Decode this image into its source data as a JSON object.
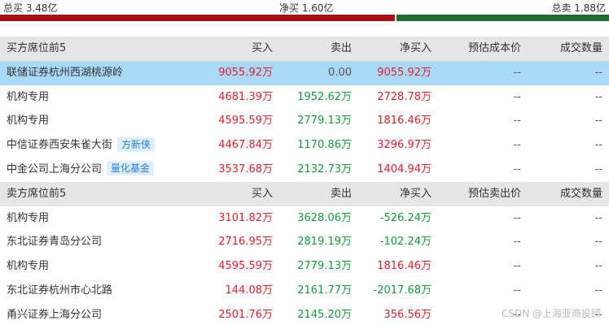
{
  "summary": {
    "buy_total": "总买 3.48亿",
    "net_buy": "净买 1.60亿",
    "sell_total": "总卖 1.88亿",
    "buy_ratio": 0.649
  },
  "colors": {
    "buy": "#a80d14",
    "sell": "#1e6b2e",
    "up": "#e5202a",
    "down": "#129c3c",
    "highlight": "#aad9f8"
  },
  "buy_table": {
    "headers": [
      "买方席位前5",
      "买入",
      "卖出",
      "净买入",
      "预估成本价",
      "成交数量"
    ],
    "rows": [
      {
        "name": "联储证券杭州西湖桃源岭",
        "badge": "",
        "buy": "9055.92万",
        "sell": "0.00",
        "net": "9055.92万",
        "cost": "--",
        "qty": "--"
      },
      {
        "name": "机构专用",
        "badge": "",
        "buy": "4681.39万",
        "sell": "1952.62万",
        "net": "2728.78万",
        "cost": "--",
        "qty": "--"
      },
      {
        "name": "机构专用",
        "badge": "",
        "buy": "4595.59万",
        "sell": "2779.13万",
        "net": "1816.46万",
        "cost": "--",
        "qty": "--"
      },
      {
        "name": "中信证券西安朱雀大街",
        "badge": "方新侠",
        "buy": "4467.84万",
        "sell": "1170.86万",
        "net": "3296.97万",
        "cost": "--",
        "qty": "--"
      },
      {
        "name": "中金公司上海分公司",
        "badge": "量化基金",
        "buy": "3537.68万",
        "sell": "2132.73万",
        "net": "1404.94万",
        "cost": "--",
        "qty": "--"
      }
    ]
  },
  "sell_table": {
    "headers": [
      "卖方席位前5",
      "买入",
      "卖出",
      "净买入",
      "预估卖出价",
      "成交数量"
    ],
    "rows": [
      {
        "name": "机构专用",
        "buy": "3101.82万",
        "sell": "3628.06万",
        "net": "-526.24万",
        "cost": "--",
        "qty": "--"
      },
      {
        "name": "东北证券青岛分公司",
        "buy": "2716.95万",
        "sell": "2819.19万",
        "net": "-102.24万",
        "cost": "--",
        "qty": "--"
      },
      {
        "name": "机构专用",
        "buy": "4595.59万",
        "sell": "2779.13万",
        "net": "1816.46万",
        "cost": "--",
        "qty": "--"
      },
      {
        "name": "东北证券杭州市心北路",
        "buy": "144.08万",
        "sell": "2161.77万",
        "net": "-2017.68万",
        "cost": "--",
        "qty": "--"
      },
      {
        "name": "甬兴证券上海分公司",
        "buy": "2501.76万",
        "sell": "2145.20万",
        "net": "356.56万",
        "cost": "--",
        "qty": "--"
      }
    ]
  },
  "watermark": "CSDN @上海亚商投顾"
}
